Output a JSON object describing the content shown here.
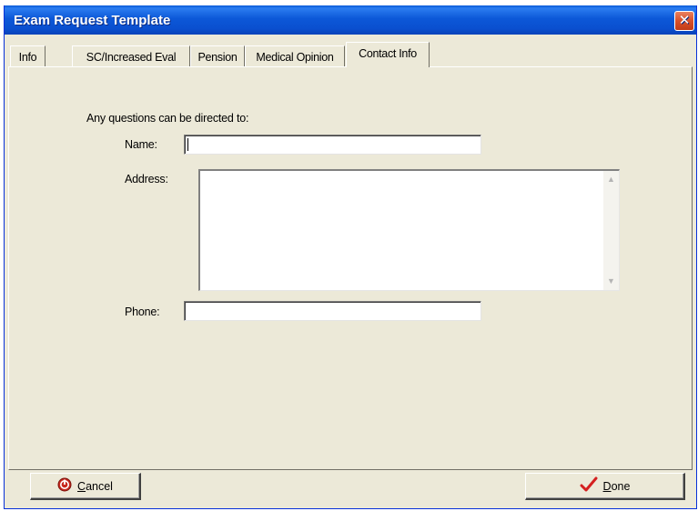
{
  "window": {
    "title": "Exam Request Template",
    "close_glyph": "✕"
  },
  "tabs": [
    {
      "label": "Info"
    },
    {
      "label": "SC/Increased Eval"
    },
    {
      "label": "Pension"
    },
    {
      "label": "Medical Opinion"
    },
    {
      "label": "Contact Info",
      "active": true
    }
  ],
  "contact": {
    "intro": "Any questions can be directed to:",
    "name_label": "Name:",
    "name_value": "",
    "address_label": "Address:",
    "address_value": "",
    "phone_label": "Phone:",
    "phone_value": ""
  },
  "buttons": {
    "cancel_first": "C",
    "cancel_rest": "ancel",
    "done_first": "D",
    "done_rest": "one"
  },
  "icons": {
    "cancel": "stop-circle-icon",
    "done": "check-icon",
    "scroll_up": "scroll-up-arrow-icon",
    "scroll_down": "scroll-down-arrow-icon"
  },
  "colors": {
    "titlebar": "#0a5bd8",
    "dialog_face": "#ece9d8",
    "cancel_icon": "#c8281e",
    "done_check": "#d42020"
  }
}
